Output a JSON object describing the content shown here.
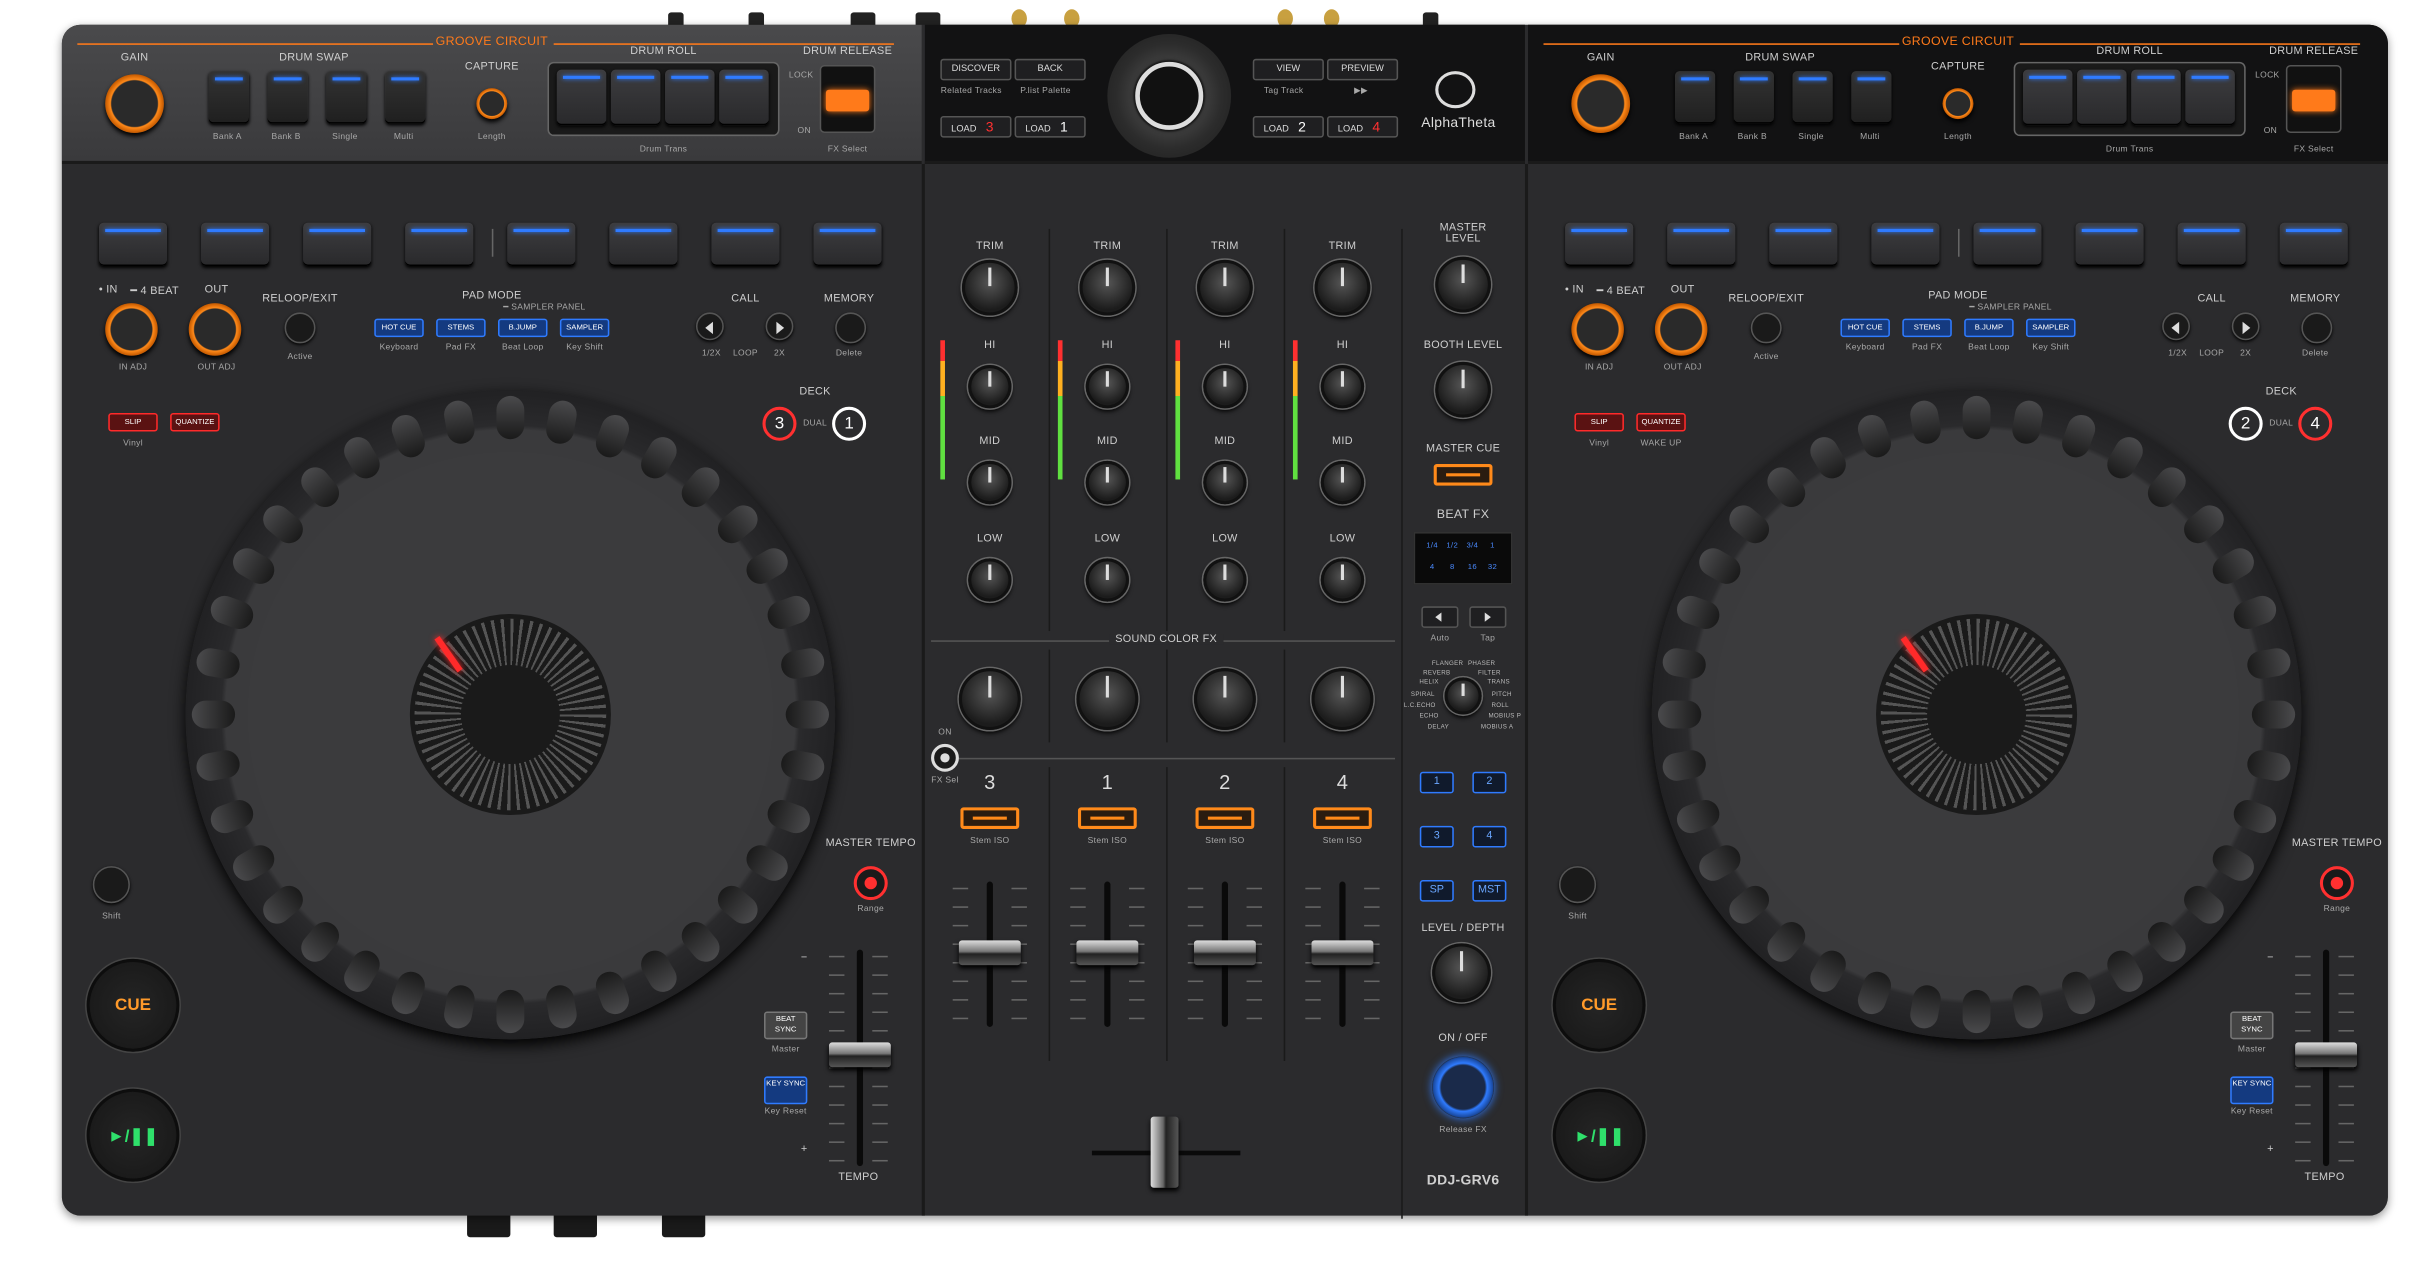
{
  "product": {
    "brand": "AlphaTheta",
    "model": "DDJ-GRV6"
  },
  "groove_circuit": {
    "title": "GROOVE CIRCUIT",
    "gain": "GAIN",
    "drum_swap": "DRUM SWAP",
    "capture": "CAPTURE",
    "drum_roll": "DRUM ROLL",
    "drum_release": "DRUM RELEASE",
    "lock": "LOCK",
    "on": "ON",
    "bank_a": "Bank A",
    "bank_b": "Bank B",
    "single": "Single",
    "multi": "Multi",
    "length": "Length",
    "drum_trans": "Drum Trans",
    "fx_select": "FX Select"
  },
  "browser": {
    "discover": "DISCOVER",
    "back": "BACK",
    "view": "VIEW",
    "preview": "PREVIEW",
    "related_tracks": "Related Tracks",
    "plist_palette": "P.list Palette",
    "tag_track": "Tag Track",
    "ff": "▶▶",
    "load_label": "LOAD",
    "load3": "3",
    "load1": "1",
    "load2": "2",
    "load4": "4"
  },
  "deck": {
    "in": "• IN",
    "four_beat": "━ 4 BEAT",
    "out": "OUT",
    "reloop_exit": "RELOOP/EXIT",
    "pad_mode": "PAD MODE",
    "sampler_panel": "━ SAMPLER PANEL",
    "call": "CALL",
    "memory": "MEMORY",
    "in_adj": "IN ADJ",
    "out_adj": "OUT ADJ",
    "active": "Active",
    "hot_cue": "HOT CUE",
    "stems": "STEMS",
    "bjump": "B.JUMP",
    "sampler": "SAMPLER",
    "keyboard": "Keyboard",
    "pad_fx": "Pad FX",
    "beat_loop": "Beat Loop",
    "key_shift": "Key Shift",
    "half": "1/2X",
    "loop": "LOOP",
    "double": "2X",
    "delete": "Delete",
    "deck": "DECK",
    "dual": "DUAL",
    "slip": "SLIP",
    "quantize": "QUANTIZE",
    "vinyl": "Vinyl",
    "wake_up": "WAKE UP",
    "shift": "Shift",
    "master_tempo": "MASTER TEMPO",
    "range": "Range",
    "cue": "CUE",
    "play": "►/❚❚",
    "beat_sync": "BEAT SYNC",
    "master": "Master",
    "key_sync": "KEY SYNC",
    "key_reset": "Key Reset",
    "tempo": "TEMPO",
    "minus": "−",
    "plus": "+",
    "left_top": "3",
    "left_bottom": "1",
    "right_top": "2",
    "right_bottom": "4"
  },
  "mixer": {
    "trim": "TRIM",
    "hi": "HI",
    "mid": "MID",
    "low": "LOW",
    "sound_color_fx": "SOUND COLOR FX",
    "on": "ON",
    "fx_sel": "FX Sel",
    "ch": [
      "3",
      "1",
      "2",
      "4"
    ],
    "stem_iso": "Stem ISO"
  },
  "master_section": {
    "master_level": "MASTER LEVEL",
    "booth_level": "BOOTH LEVEL",
    "master_cue": "MASTER CUE",
    "beat_fx": "BEAT FX",
    "beats": [
      "1/4",
      "1/2",
      "3/4",
      "1",
      "4",
      "8",
      "16",
      "32"
    ],
    "auto": "Auto",
    "tap": "Tap",
    "fx_types": [
      "FLANGER",
      "PHASER",
      "REVERB",
      "FILTER",
      "HELIX",
      "TRANS",
      "SPIRAL",
      "PITCH",
      "L.C.ECHO",
      "ROLL",
      "ECHO",
      "MOBIUS P",
      "DELAY",
      "MOBIUS A"
    ],
    "ch_btns": [
      "1",
      "2",
      "3",
      "4",
      "SP",
      "MST"
    ],
    "level_depth": "LEVEL / DEPTH",
    "on_off": "ON / OFF",
    "release_fx": "Release FX"
  },
  "colors": {
    "accent": "#ff7a1a",
    "blue": "#2f7bff",
    "red": "#ff2a2a",
    "green": "#2fe06b"
  }
}
